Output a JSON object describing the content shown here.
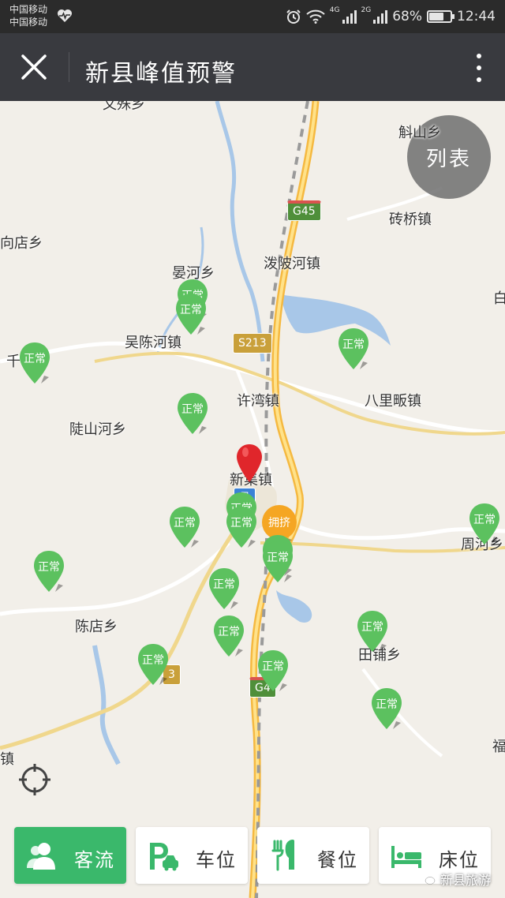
{
  "status_bar": {
    "carrier_1": "中国移动",
    "carrier_2": "中国移动",
    "network_1": "4G",
    "network_2": "2G",
    "battery": "68%",
    "battery_level": 0.68,
    "time": "12:44"
  },
  "title_bar": {
    "title": "新县峰值预警",
    "close_icon": "close-icon",
    "more_icon": "more-vertical-icon"
  },
  "map": {
    "list_button": "列表",
    "places": [
      {
        "label": "斛山乡"
      },
      {
        "label": "砖桥镇"
      },
      {
        "label": "向店乡"
      },
      {
        "label": "泼陂河镇"
      },
      {
        "label": "晏河乡"
      },
      {
        "label": "吴陈河镇"
      },
      {
        "label": "千"
      },
      {
        "label": "许湾镇"
      },
      {
        "label": "八里畈镇"
      },
      {
        "label": "陡山河乡"
      },
      {
        "label": "新集镇"
      },
      {
        "label": "周河乡"
      },
      {
        "label": "陈店乡"
      },
      {
        "label": "田铺乡"
      },
      {
        "label": "福"
      },
      {
        "label": "镇"
      },
      {
        "label": "白"
      },
      {
        "label": "文殊乡"
      }
    ],
    "road_shields": [
      "G45",
      "S213",
      "G4",
      "县",
      "3"
    ],
    "markers_normal_label": "正常",
    "marker_congested_label": "拥挤",
    "locate_icon": "locate-icon"
  },
  "tabs": [
    {
      "label": "客流",
      "icon": "people-icon",
      "active": true
    },
    {
      "label": "车位",
      "icon": "parking-icon",
      "active": false
    },
    {
      "label": "餐位",
      "icon": "dining-icon",
      "active": false
    },
    {
      "label": "床位",
      "icon": "bed-icon",
      "active": false
    }
  ],
  "watermark": "新县旅游",
  "colors": {
    "accent_green": "#3ab86b",
    "marker_green": "#5cc15f",
    "marker_orange": "#f5a623",
    "title_bar": "#393a3f"
  }
}
